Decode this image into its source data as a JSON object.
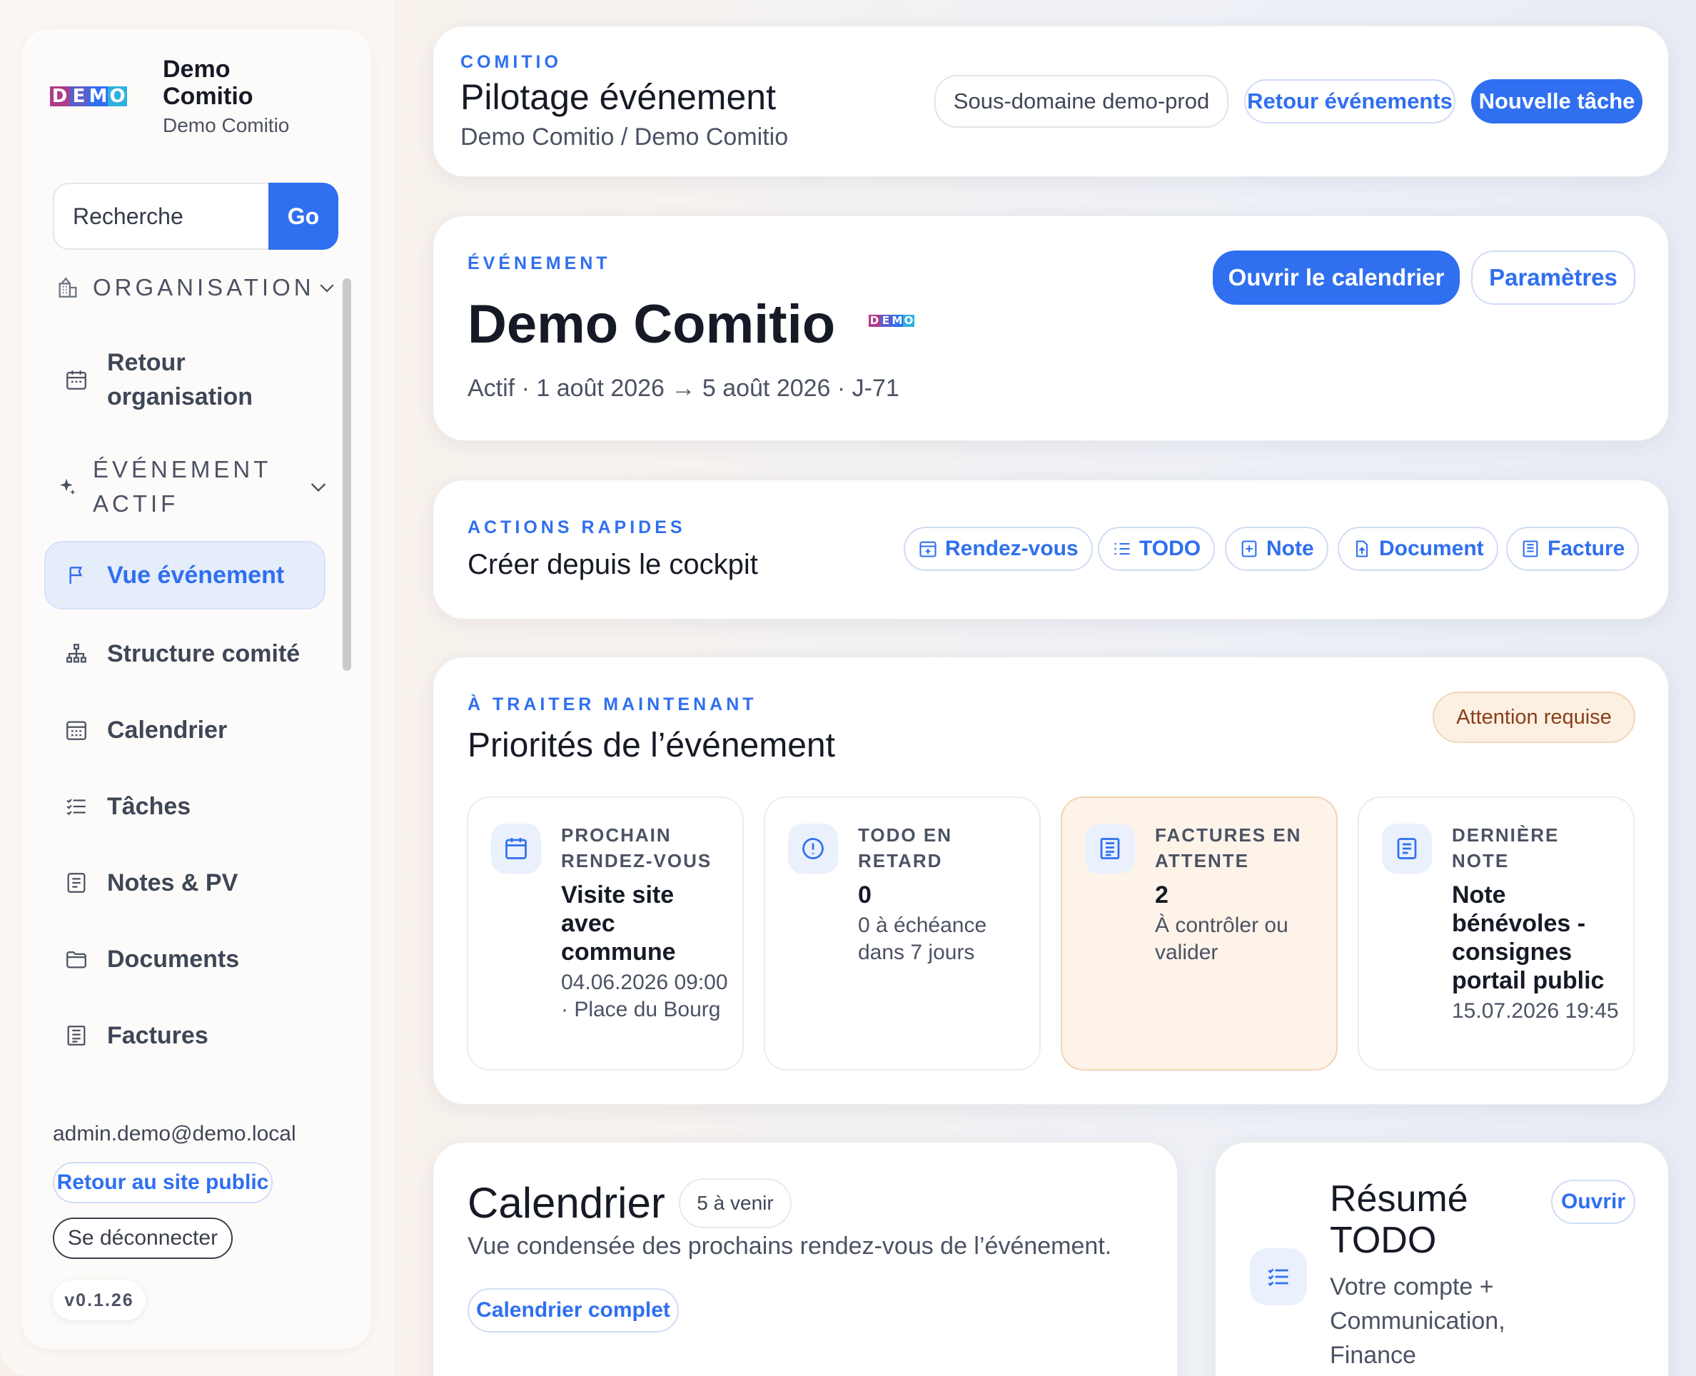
{
  "sidebar": {
    "brand_title_1": "Demo",
    "brand_title_2": "Comitio",
    "brand_subtitle": "Demo Comitio",
    "logo_letters": [
      "D",
      "E",
      "M",
      "O"
    ],
    "logo_colors": [
      "#b03a8c",
      "#5b5fc7",
      "#2f6ff0",
      "#2fb0e0"
    ],
    "search_placeholder": "Recherche",
    "search_button": "Go",
    "section_organisation": "ORGANISATION",
    "item_retour_org_1": "Retour",
    "item_retour_org_2": "organisation",
    "section_event_1": "ÉVÉNEMENT",
    "section_event_2": "ACTIF",
    "items": [
      {
        "label": "Vue événement",
        "icon": "flag-icon"
      },
      {
        "label": "Structure comité",
        "icon": "org-tree-icon"
      },
      {
        "label": "Calendrier",
        "icon": "calendar-grid-icon"
      },
      {
        "label": "Tâches",
        "icon": "checklist-icon"
      },
      {
        "label": "Notes & PV",
        "icon": "note-icon"
      },
      {
        "label": "Documents",
        "icon": "folder-icon"
      },
      {
        "label": "Factures",
        "icon": "invoice-icon"
      }
    ],
    "user_email": "admin.demo@demo.local",
    "public_site_button": "Retour au site public",
    "logout_button": "Se déconnecter",
    "version": "v0.1.26"
  },
  "header": {
    "eyebrow": "COMITIO",
    "title": "Pilotage événement",
    "breadcrumb": "Demo Comitio / Demo Comitio",
    "subdomain_chip": "Sous-domaine demo-prod",
    "back_events_button": "Retour événements",
    "new_task_button": "Nouvelle tâche"
  },
  "event": {
    "eyebrow": "ÉVÉNEMENT",
    "name": "Demo Comitio",
    "meta": "Actif · 1 août 2026 → 5 août 2026 · J-71",
    "open_calendar_button": "Ouvrir le calendrier",
    "settings_button": "Paramètres"
  },
  "quick_actions": {
    "eyebrow": "ACTIONS RAPIDES",
    "title": "Créer depuis le cockpit",
    "buttons": [
      {
        "label": "Rendez-vous",
        "icon": "calendar-plus-icon"
      },
      {
        "label": "TODO",
        "icon": "checklist-icon"
      },
      {
        "label": "Note",
        "icon": "note-plus-icon"
      },
      {
        "label": "Document",
        "icon": "document-upload-icon"
      },
      {
        "label": "Facture",
        "icon": "invoice-icon"
      }
    ]
  },
  "priorities": {
    "eyebrow": "À TRAITER MAINTENANT",
    "title": "Priorités de l’événement",
    "badge": "Attention requise",
    "cards": [
      {
        "label": "PROCHAIN RENDEZ-VOUS",
        "value": "Visite site avec commune",
        "sub": "04.06.2026 09:00 · Place du Bourg",
        "icon": "calendar-icon"
      },
      {
        "label": "TODO EN RETARD",
        "value": "0",
        "sub": "0 à échéance dans 7 jours",
        "icon": "alert-circle-icon"
      },
      {
        "label": "FACTURES EN ATTENTE",
        "value": "2",
        "sub": "À contrôler ou valider",
        "icon": "invoice-icon"
      },
      {
        "label": "DERNIÈRE NOTE",
        "value": "Note bénévoles - consignes portail public",
        "sub": "15.07.2026 19:45",
        "icon": "note-icon"
      }
    ]
  },
  "calendar_card": {
    "title": "Calendrier",
    "badge": "5 à venir",
    "description": "Vue condensée des prochains rendez-vous de l’événement.",
    "full_button": "Calendrier complet"
  },
  "todo_card": {
    "title": "Résumé TODO",
    "open_button": "Ouvrir",
    "description": "Votre compte + Communication, Finance"
  }
}
